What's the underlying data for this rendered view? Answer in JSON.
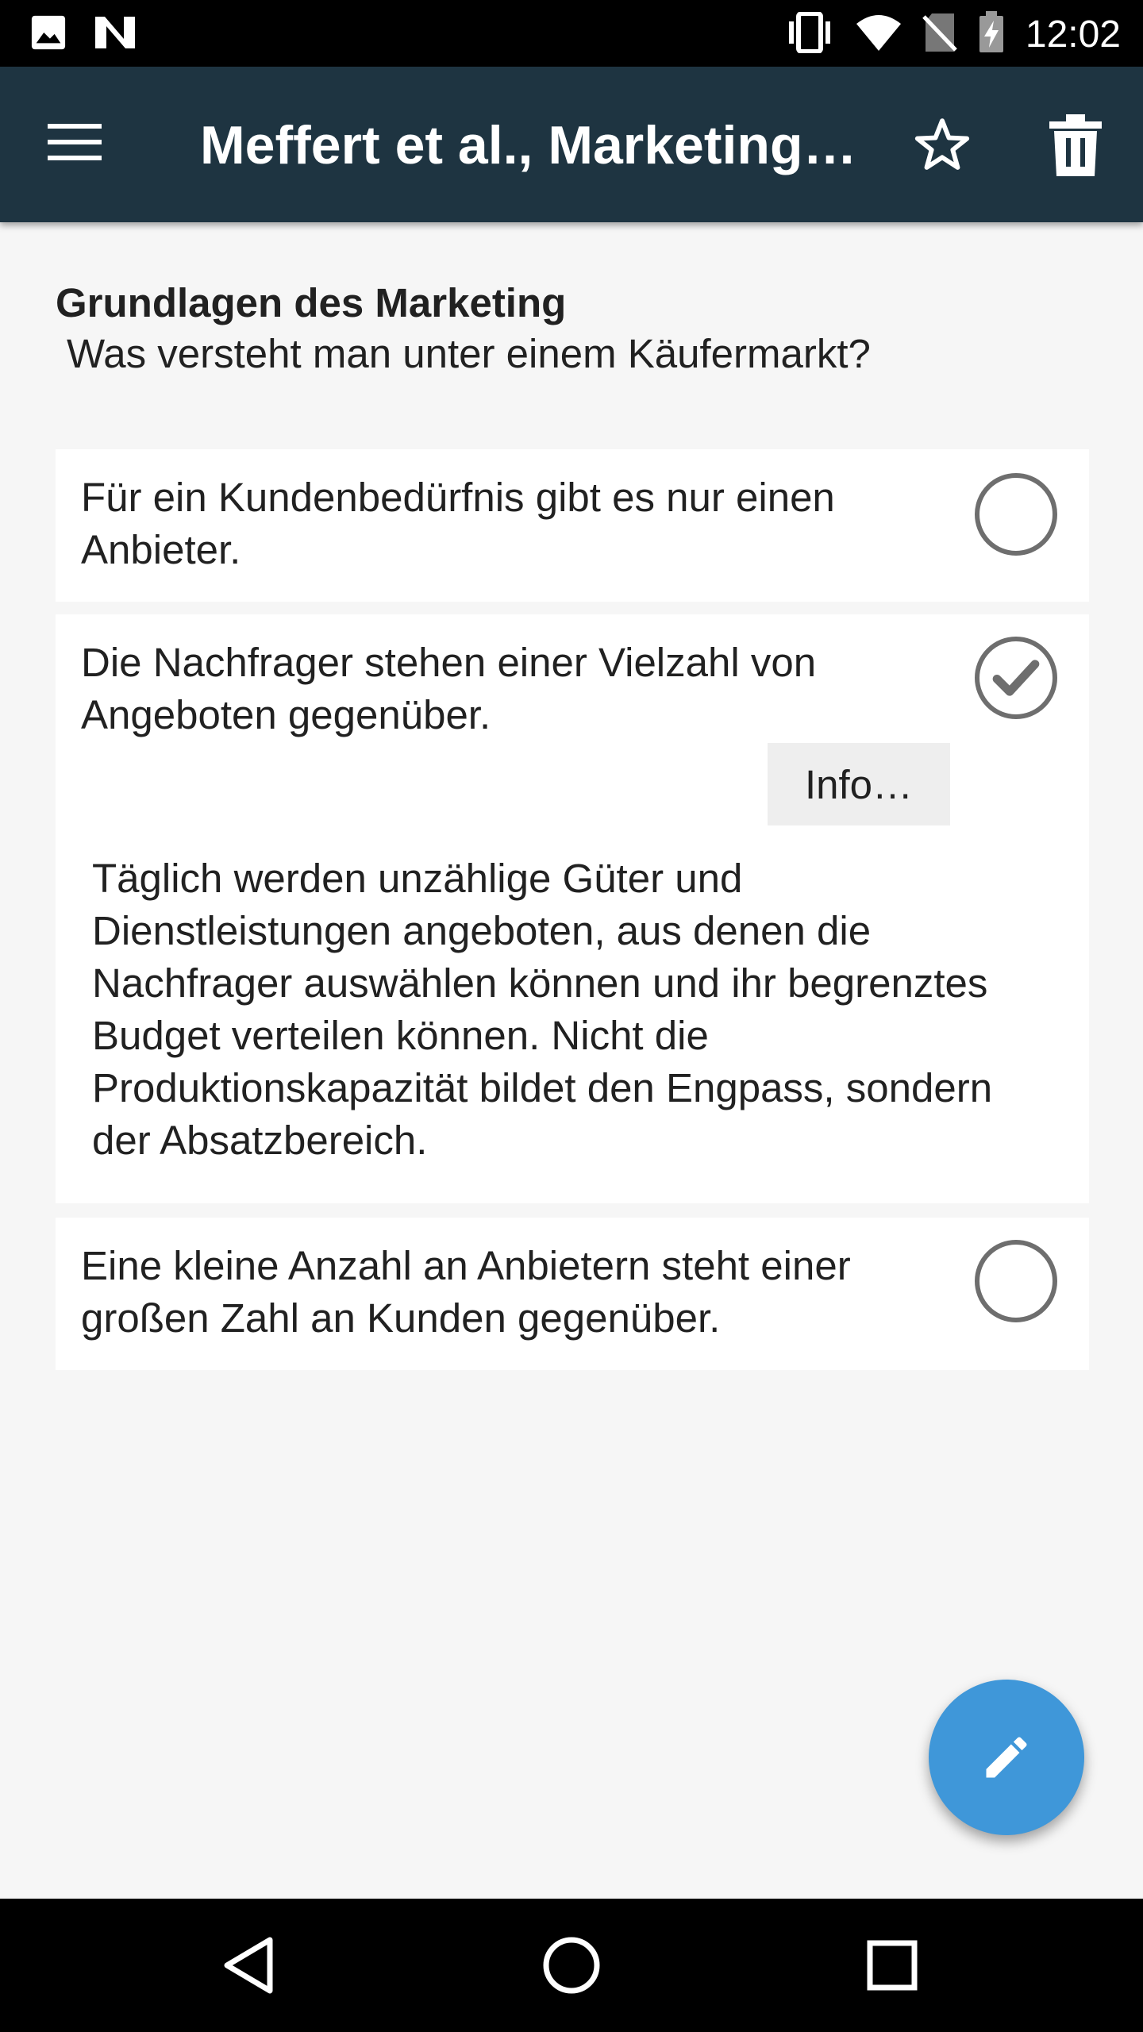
{
  "status_bar": {
    "time": "12:02",
    "icons": [
      "image-icon",
      "n-icon",
      "vibrate-icon",
      "wifi-icon",
      "no-sim-icon",
      "battery-charging-icon"
    ]
  },
  "app_bar": {
    "title": "Meffert et al., Marketing,…",
    "icons": [
      "menu-icon",
      "star-icon",
      "trash-icon"
    ],
    "background_color": "#1e3441"
  },
  "quiz": {
    "category": "Grundlagen des Marketing",
    "question": "Was versteht man unter einem Käufermarkt?",
    "answers": [
      {
        "text": "Für ein Kundenbedürfnis gibt es nur einen Anbieter.",
        "checked": false
      },
      {
        "text": "Die Nachfrager stehen einer Vielzahl von Angeboten gegenüber.",
        "checked": true,
        "info_button": "Info…",
        "explanation": "Täglich werden unzählige Güter und Dienstleistungen angeboten, aus denen die Nachfrager auswählen können und ihr begrenztes Budget verteilen können. Nicht die Produktionskapazität bildet den Engpass, sondern der Absatzbereich."
      },
      {
        "text": "Eine kleine Anzahl an Anbietern steht einer großen Zahl an Kunden gegenüber.",
        "checked": false
      }
    ]
  },
  "fab": {
    "icon": "pencil-icon",
    "color": "#3f97d9"
  },
  "nav_bar": {
    "icons": [
      "back-icon",
      "home-icon",
      "recents-icon"
    ]
  }
}
